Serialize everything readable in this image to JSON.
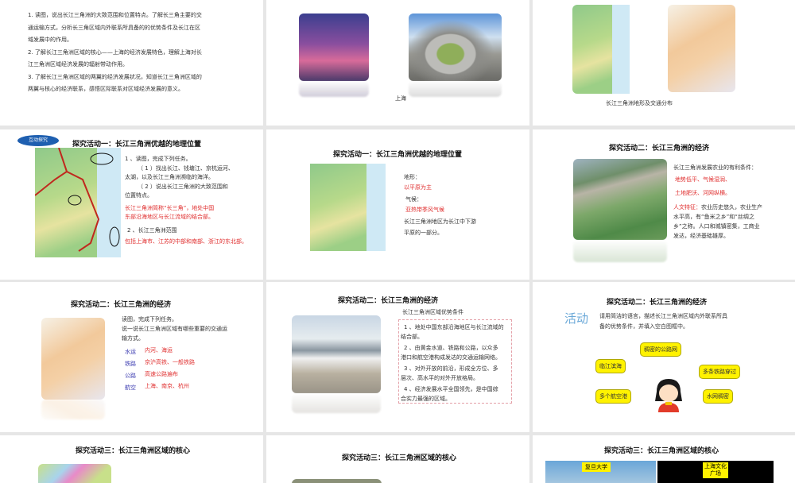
{
  "slides": [
    {
      "lines": [
        "1. 读图，说出长江三角洲的大致范围和位置特点。了解长三角主要的交",
        "通运输方式，分析长三角区域内外联系所具备的的优势条件及长江在区",
        "域发展中的作用。",
        "2. 了解长江三角洲区域的核心——上海的经济发展特色，理解上海对长",
        "江三角洲区域经济发展的辐射带动作用。",
        "3. 了解长江三角洲区域的两翼的经济发展状况，知道长江三角洲区域的",
        "两翼与核心的经济联系，感悟区际联系对区域经济发展的意义。"
      ]
    },
    {
      "caption": "上海"
    },
    {
      "caption": "长江三角洲地形及交通分布"
    },
    {
      "badge": "互动探究",
      "title": "探究活动一：长江三角洲优越的地理位置",
      "task": "1 、读图，完成下列任务。",
      "sub1a": "（ 1 ）找出长江、钱塘江、京杭运河、",
      "sub1b": "太湖，以及长江三角洲濒临的海洋。",
      "sub2a": "（ 2 ）说出长江三角洲的大致范围和",
      "sub2b": "位置特点。",
      "ans1a": "长江三角洲简称“长三角”，地处中国",
      "ans1b": "东部沿海地区与长江流域的结合部。",
      "task2": "2 、长江三角洲范围",
      "ans2": "包括上海市、江苏的中部和南部、浙江的东北部。"
    },
    {
      "title": "探究活动一：长江三角洲优越的地理位置",
      "terrain_label": "地形：",
      "terrain": "以平原为主",
      "climate_label": "气候：",
      "climate": "亚热带季风气候",
      "note1": "长江三角洲地区为长江中下游",
      "note2": "平原的一部分。"
    },
    {
      "title": "探究活动二：长江三角洲的经济",
      "intro": "长江三角洲发展农业的有利条件：",
      "c1": "地势低平、气候湿润、",
      "c2": "土地肥沃、河网纵横。",
      "human_label": "人文特征：",
      "h1": "农业历史悠久，农业生产",
      "h2": "水平高，有“鱼米之乡”和“丝绸之",
      "h3": "乡”之称。人口和城镇密集，工商业",
      "h4": "发达，经济基础雄厚。"
    },
    {
      "title": "探究活动二：长江三角洲的经济",
      "q1": "读图，完成下列任务。",
      "q2": "说一说长江三角洲区域有哪些重要的交通运",
      "q3": "输方式。",
      "rows": [
        {
          "k": "水运",
          "v": "内河、海运"
        },
        {
          "k": "铁路",
          "v": "京沪高铁、一般铁路"
        },
        {
          "k": "公路",
          "v": "高速公路遍布"
        },
        {
          "k": "航空",
          "v": "上海、南京、杭州"
        }
      ]
    },
    {
      "title": "探究活动二：长江三角洲的经济",
      "subtitle": "长江三角洲区域优势条件",
      "p1a": "1 、地处中国东部沿海地区与长江流域的",
      "p1b": "结合部。",
      "p2a": "2 、由黄金水道、铁路和公路，以众多",
      "p2b": "港口和航空港构成发达的交通运输网络。",
      "p3a": "3 、对外开放的前沿，形成全方位、多",
      "p3b": "层次、高水平的对外开放格局。",
      "p4a": "4 、经济发展水平全国领先，是中国综",
      "p4b": "合实力最强的区域。"
    },
    {
      "title": "探究活动二：长江三角洲的经济",
      "activity": "活动",
      "d1": "请用简洁的语言，描述长江三角洲区域内外联系所具",
      "d2": "备的优势条件，并填入空白图框中。",
      "bubbles": [
        "稠密的公路网",
        "临江滨海",
        "多条铁路穿过",
        "多个航空港",
        "水网稠密"
      ]
    },
    {
      "title": "探究活动三：长江三角洲区域的核心"
    },
    {
      "title": "探究活动三：长江三角洲区域的核心"
    },
    {
      "title": "探究活动三：长江三角洲区域的核心",
      "label1": "复旦大学",
      "label2": "上海文化广场"
    }
  ]
}
